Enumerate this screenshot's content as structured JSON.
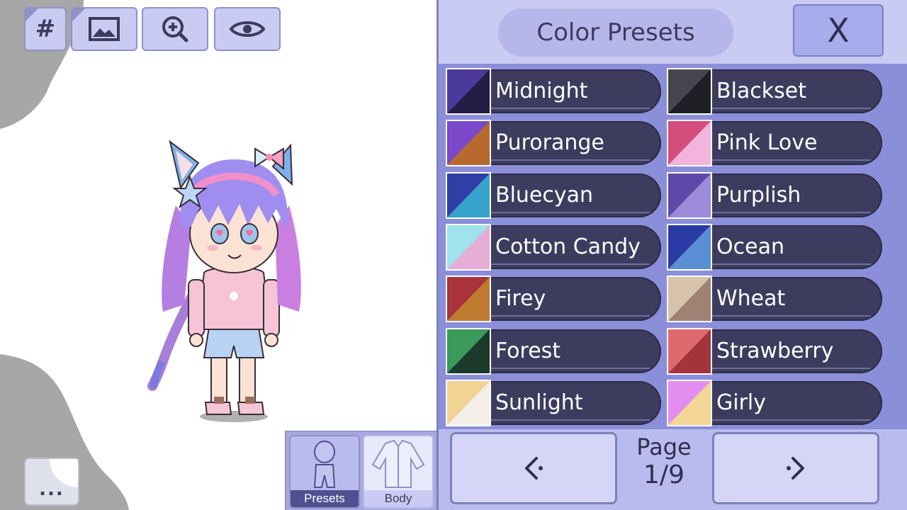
{
  "toolbar": {
    "buttons": [
      {
        "name": "hash-button",
        "icon": "hash-icon",
        "glyph": "#"
      },
      {
        "name": "background-button",
        "icon": "image-icon"
      },
      {
        "name": "zoom-button",
        "icon": "zoom-in-icon"
      },
      {
        "name": "visibility-button",
        "icon": "eye-icon"
      }
    ]
  },
  "more_button": {
    "label": "..."
  },
  "tabs": [
    {
      "label": "Presets",
      "active": true
    },
    {
      "label": "Body",
      "active": false
    }
  ],
  "panel": {
    "title": "Color Presets",
    "close_label": "X"
  },
  "presets": [
    {
      "label": "Midnight",
      "colors": [
        "#4b3a9c",
        "#251d45"
      ]
    },
    {
      "label": "Blackset",
      "colors": [
        "#464650",
        "#1f1f26"
      ]
    },
    {
      "label": "Purorange",
      "colors": [
        "#7a48c8",
        "#b86a2e"
      ]
    },
    {
      "label": "Pink Love",
      "colors": [
        "#d54d7c",
        "#f2b4dc"
      ]
    },
    {
      "label": "Bluecyan",
      "colors": [
        "#2f3fa6",
        "#36a3cc"
      ]
    },
    {
      "label": "Purplish",
      "colors": [
        "#5e48a8",
        "#9b8bd8"
      ]
    },
    {
      "label": "Cotton Candy",
      "colors": [
        "#9fe3ec",
        "#e6aed6"
      ]
    },
    {
      "label": "Ocean",
      "colors": [
        "#2a3ba6",
        "#5b8fd4"
      ]
    },
    {
      "label": "Firey",
      "colors": [
        "#a8333c",
        "#be7b30"
      ]
    },
    {
      "label": "Wheat",
      "colors": [
        "#d7c2ac",
        "#9f8274"
      ]
    },
    {
      "label": "Forest",
      "colors": [
        "#3a9a5a",
        "#1a3a2a"
      ]
    },
    {
      "label": "Strawberry",
      "colors": [
        "#df6a6e",
        "#a2343c"
      ]
    },
    {
      "label": "Sunlight",
      "colors": [
        "#f1d494",
        "#f3efe8"
      ]
    },
    {
      "label": "Girly",
      "colors": [
        "#e28ef0",
        "#f4d696"
      ]
    }
  ],
  "pager": {
    "page_word": "Page",
    "page_number": "1/9",
    "prev_icon": "chevron-left-icon",
    "next_icon": "chevron-right-icon"
  }
}
